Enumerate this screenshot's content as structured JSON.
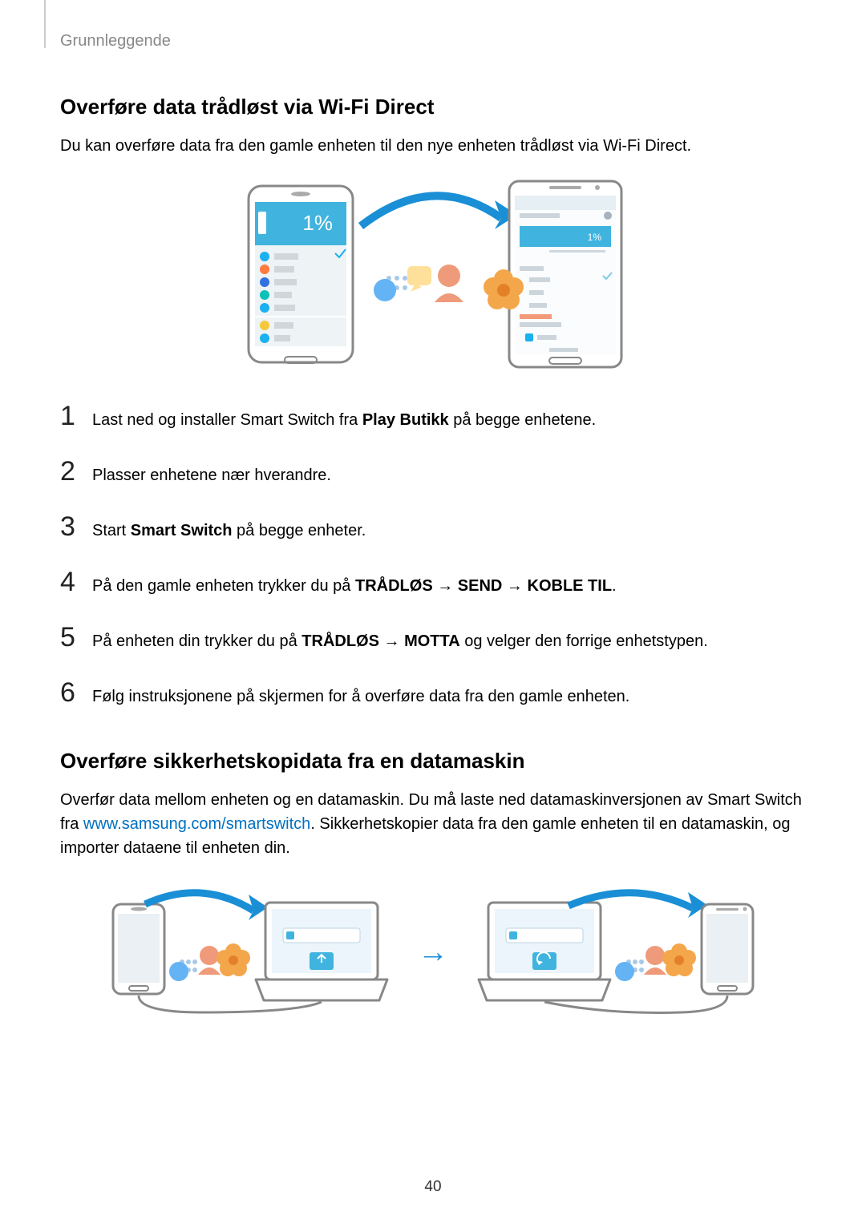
{
  "breadcrumb": "Grunnleggende",
  "section1": {
    "heading": "Overføre data trådløst via Wi-Fi Direct",
    "intro": "Du kan overføre data fra den gamle enheten til den nye enheten trådløst via Wi-Fi Direct."
  },
  "steps": [
    {
      "n": "1",
      "parts": [
        {
          "text": "Last ned og installer Smart Switch fra ",
          "bold": false
        },
        {
          "text": "Play Butikk",
          "bold": true
        },
        {
          "text": " på begge enhetene.",
          "bold": false
        }
      ]
    },
    {
      "n": "2",
      "parts": [
        {
          "text": "Plasser enhetene nær hverandre.",
          "bold": false
        }
      ]
    },
    {
      "n": "3",
      "parts": [
        {
          "text": "Start ",
          "bold": false
        },
        {
          "text": "Smart Switch",
          "bold": true
        },
        {
          "text": " på begge enheter.",
          "bold": false
        }
      ]
    },
    {
      "n": "4",
      "parts": [
        {
          "text": "På den gamle enheten trykker du på ",
          "bold": false
        },
        {
          "text": "TRÅDLØS",
          "bold": true
        },
        {
          "text": " → ",
          "bold": false
        },
        {
          "text": "SEND",
          "bold": true
        },
        {
          "text": " → ",
          "bold": false
        },
        {
          "text": "KOBLE TIL",
          "bold": true
        },
        {
          "text": ".",
          "bold": false
        }
      ]
    },
    {
      "n": "5",
      "parts": [
        {
          "text": "På enheten din trykker du på ",
          "bold": false
        },
        {
          "text": "TRÅDLØS",
          "bold": true
        },
        {
          "text": " → ",
          "bold": false
        },
        {
          "text": "MOTTA",
          "bold": true
        },
        {
          "text": " og velger den forrige enhetstypen.",
          "bold": false
        }
      ]
    },
    {
      "n": "6",
      "parts": [
        {
          "text": "Følg instruksjonene på skjermen for å overføre data fra den gamle enheten.",
          "bold": false
        }
      ]
    }
  ],
  "section2": {
    "heading": "Overføre sikkerhetskopidata fra en datamaskin",
    "intro_pre": "Overfør data mellom enheten og en datamaskin. Du må laste ned datamaskinversjonen av Smart Switch fra ",
    "link": "www.samsung.com/smartswitch",
    "intro_post": ". Sikkerhetskopier data fra den gamle enheten til en datamaskin, og importer dataene til enheten din."
  },
  "arrow_glyph": "→",
  "page_number": "40"
}
